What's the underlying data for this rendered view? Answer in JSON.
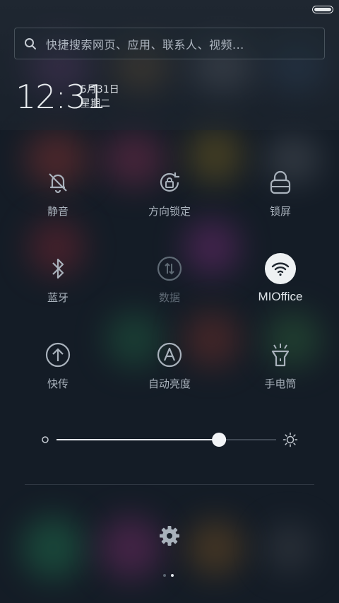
{
  "status_bar": {
    "battery_icon": "battery-full-icon"
  },
  "search": {
    "placeholder": "快捷搜索网页、应用、联系人、视频...",
    "icon": "search-icon"
  },
  "clock": {
    "time": "12:31",
    "date": "5月31日",
    "weekday": "星期二"
  },
  "toggles": [
    {
      "label": "静音",
      "icon": "bell-off-icon",
      "state": "off"
    },
    {
      "label": "方向锁定",
      "icon": "rotation-lock-icon",
      "state": "off"
    },
    {
      "label": "锁屏",
      "icon": "lock-icon",
      "state": "off"
    },
    {
      "label": "蓝牙",
      "icon": "bluetooth-icon",
      "state": "off"
    },
    {
      "label": "数据",
      "icon": "mobile-data-icon",
      "state": "disabled"
    },
    {
      "label": "MIOffice",
      "icon": "wifi-icon",
      "state": "on"
    },
    {
      "label": "快传",
      "icon": "quick-transfer-icon",
      "state": "off"
    },
    {
      "label": "自动亮度",
      "icon": "auto-brightness-icon",
      "state": "off"
    },
    {
      "label": "手电筒",
      "icon": "flashlight-icon",
      "state": "off"
    }
  ],
  "brightness": {
    "level": 0.74,
    "min_icon": "brightness-low-icon",
    "max_icon": "brightness-high-icon"
  },
  "settings": {
    "icon": "gear-icon"
  },
  "pager": {
    "pages": 2,
    "active_index": 1
  },
  "colors": {
    "accent_on": "#eef1f3",
    "text": "#a9b2bc",
    "background": "#141c26"
  }
}
